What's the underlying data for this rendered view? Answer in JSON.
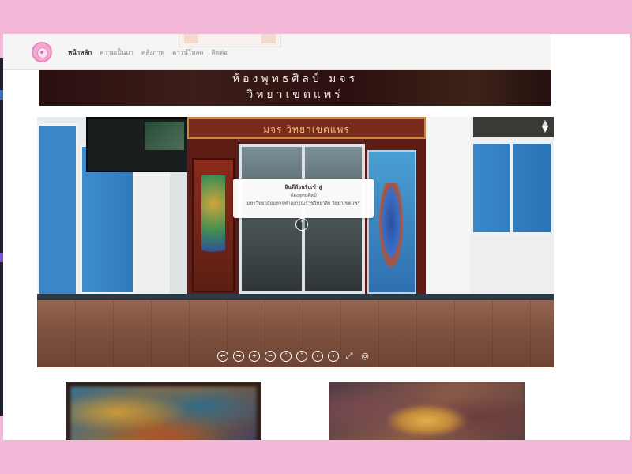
{
  "nav": {
    "items": [
      {
        "label": "หน้าหลัก",
        "active": true
      },
      {
        "label": "ความเป็นมา",
        "active": false
      },
      {
        "label": "คลังภาพ",
        "active": false
      },
      {
        "label": "ดาวน์โหลด",
        "active": false
      },
      {
        "label": "ติดต่อ",
        "active": false
      }
    ]
  },
  "banner": {
    "line1": "ห้องพุทธศิลป์ มจร",
    "line2": "วิทยาเขตแพร่"
  },
  "viewer": {
    "sign_text": "มจร วิทยาเขตแพร่",
    "popup": {
      "title": "ยินดีต้อนรับเข้าสู่",
      "subtitle": "ห้องพุทธศิลป์",
      "description": "มหาวิทยาลัยมหาจุฬาลงกรณราชวิทยาลัย วิทยาเขตแพร่"
    },
    "hotspot_icon": "chevron-up-icon",
    "compass_icon": "compass-icon",
    "controls": [
      {
        "name": "pan-left-button",
        "glyph": "←"
      },
      {
        "name": "pan-right-button",
        "glyph": "→"
      },
      {
        "name": "zoom-in-button",
        "glyph": "+"
      },
      {
        "name": "zoom-out-button",
        "glyph": "−"
      },
      {
        "name": "pan-up-button",
        "glyph": "˄"
      },
      {
        "name": "pan-down-button",
        "glyph": "˅"
      },
      {
        "name": "rotate-left-button",
        "glyph": "‹"
      },
      {
        "name": "rotate-right-button",
        "glyph": "›"
      },
      {
        "name": "fullscreen-button",
        "glyph": "⤢"
      },
      {
        "name": "hide-hotspots-button",
        "glyph": "◎"
      }
    ]
  },
  "colors": {
    "frame_pink": "#f3b7d7",
    "logo_pink": "#e987bd",
    "banner_bg": "#2b0f0f"
  }
}
